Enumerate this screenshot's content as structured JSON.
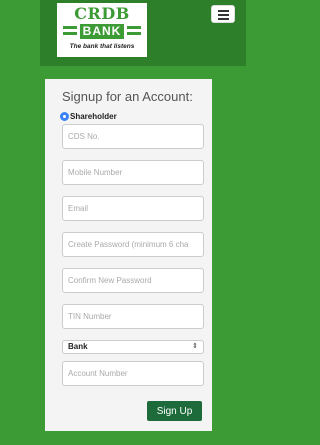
{
  "header": {
    "logo_text": "CRDB",
    "logo_bank": "BANK",
    "logo_tagline": "The bank that listens",
    "menu_icon": "hamburger-menu-icon"
  },
  "form": {
    "title": "Signup for an Account:",
    "account_type": "Shareholder",
    "fields": [
      {
        "placeholder": "CDS No."
      },
      {
        "placeholder": "Mobile Number"
      },
      {
        "placeholder": "Email"
      },
      {
        "placeholder": "Create Password (minimum 6 cha"
      },
      {
        "placeholder": "Confirm New Password"
      },
      {
        "placeholder": "TIN Number"
      }
    ],
    "bank_select": "Bank",
    "account_number_placeholder": "Account Number",
    "submit_label": "Sign Up"
  },
  "colors": {
    "brand_green": "#3d9b35",
    "button_green": "#1d6b3a",
    "radio_blue": "#3b82f6"
  }
}
